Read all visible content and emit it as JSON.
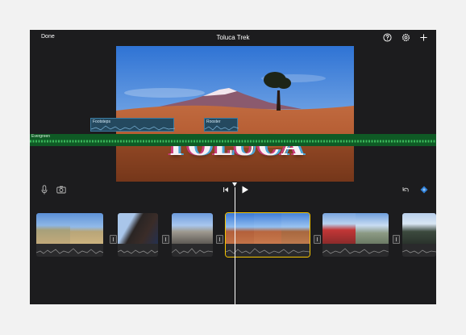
{
  "header": {
    "done_label": "Done",
    "title": "Toluca Trek"
  },
  "preview": {
    "overlay_title": "TOLUCA"
  },
  "audio_tracks": {
    "sound_effects": [
      {
        "label": "Footsteps"
      },
      {
        "label": "Rooster"
      }
    ],
    "music": {
      "label": "Evergreen"
    }
  },
  "icons": {
    "help": "help-circle-icon",
    "settings": "gear-icon",
    "add": "plus-icon",
    "mic": "microphone-icon",
    "camera": "camera-icon",
    "skip_back": "skip-to-start-icon",
    "play": "play-icon",
    "undo": "undo-icon",
    "keyframe": "diamond-icon"
  },
  "colors": {
    "selection": "#f5c400",
    "sfx": "#24495f",
    "music": "#0f5a25",
    "accent": "#2f7fd6"
  }
}
